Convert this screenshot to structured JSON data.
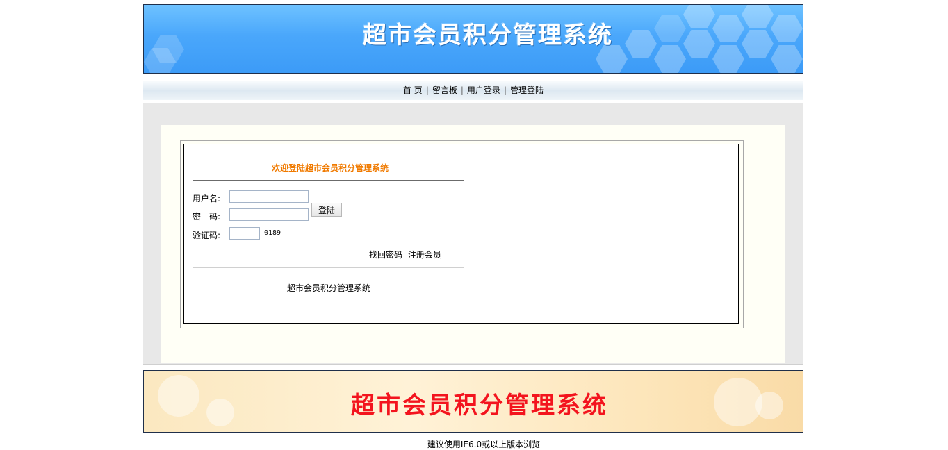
{
  "header": {
    "title": "超市会员积分管理系统"
  },
  "nav": {
    "items": [
      {
        "label": "首 页"
      },
      {
        "label": "留言板"
      },
      {
        "label": "用户登录"
      },
      {
        "label": "管理登陆"
      }
    ],
    "separator": "|"
  },
  "login": {
    "title": "欢迎登陆超市会员积分管理系统",
    "username_label": "用户名:",
    "username_value": "",
    "password_label": "密　码:",
    "password_value": "",
    "captcha_label": "验证码:",
    "captcha_value": "",
    "captcha_code": "0189",
    "submit_label": "登陆",
    "forgot_password": "找回密码",
    "register": "注册会员",
    "footer_text": "超市会员积分管理系统"
  },
  "footer": {
    "banner_title": "超市会员积分管理系统",
    "copyright": "建议使用IE6.0或以上版本浏览"
  },
  "colors": {
    "header_blue": "#4aa7fb",
    "login_title_orange": "#f07a00",
    "footer_title_red": "#f3141e",
    "main_bg": "#e8e8e8",
    "content_bg": "#fffff6"
  }
}
